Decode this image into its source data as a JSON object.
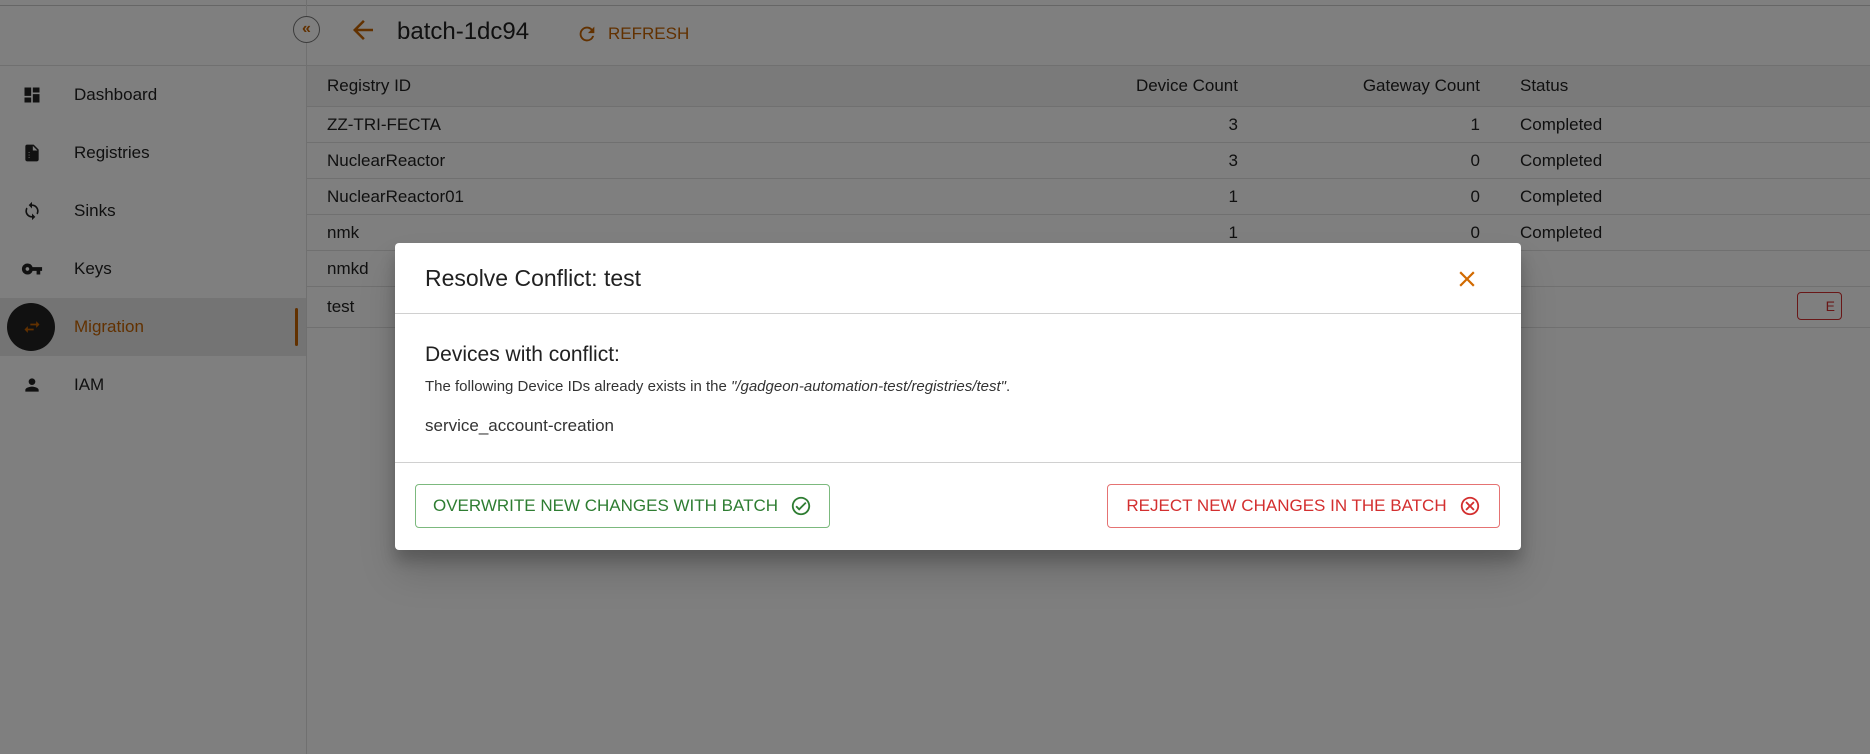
{
  "header": {
    "title": "batch-1dc94",
    "refresh_label": "REFRESH",
    "collapse_glyph": "«"
  },
  "sidebar": {
    "items": [
      {
        "label": "Dashboard",
        "icon": "dashboard-icon",
        "active": false
      },
      {
        "label": "Registries",
        "icon": "document-icon",
        "active": false
      },
      {
        "label": "Sinks",
        "icon": "sync-icon",
        "active": false
      },
      {
        "label": "Keys",
        "icon": "key-icon",
        "active": false
      },
      {
        "label": "Migration",
        "icon": "swap-icon",
        "active": true
      },
      {
        "label": "IAM",
        "icon": "person-icon",
        "active": false
      }
    ]
  },
  "table": {
    "columns": [
      "Registry ID",
      "Device Count",
      "Gateway Count",
      "Status"
    ],
    "rows": [
      {
        "id": "ZZ-TRI-FECTA",
        "devices": "3",
        "gateways": "1",
        "status": "Completed"
      },
      {
        "id": "NuclearReactor",
        "devices": "3",
        "gateways": "0",
        "status": "Completed"
      },
      {
        "id": "NuclearReactor01",
        "devices": "1",
        "gateways": "0",
        "status": "Completed"
      },
      {
        "id": "nmk",
        "devices": "1",
        "gateways": "0",
        "status": "Completed"
      },
      {
        "id": "nmkd",
        "devices": "",
        "gateways": "",
        "status": ""
      },
      {
        "id": "test",
        "devices": "",
        "gateways": "",
        "status": "",
        "action_fragment": "E"
      }
    ]
  },
  "dialog": {
    "title": "Resolve Conflict: test",
    "subtitle": "Devices with conflict:",
    "description_prefix": "The following Device IDs already exists in the ",
    "description_path": "\"/gadgeon-automation-test/registries/test\"",
    "description_suffix": ".",
    "devices": [
      "service_account-creation"
    ],
    "overwrite_label": "OVERWRITE NEW CHANGES WITH BATCH",
    "reject_label": "REJECT NEW CHANGES IN THE BATCH"
  },
  "colors": {
    "accent": "#c46200",
    "success": "#2e7d32",
    "danger": "#d32f2f"
  }
}
